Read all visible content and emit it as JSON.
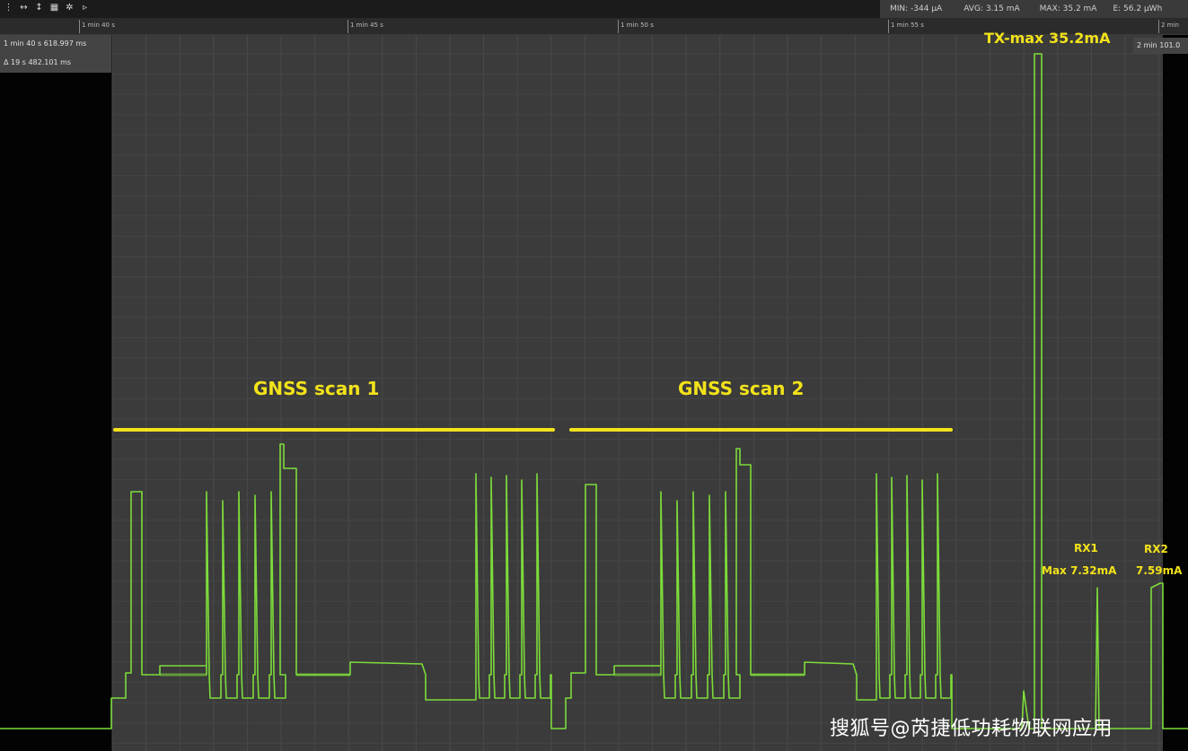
{
  "toolbar": {
    "icons": [
      "more-icon",
      "expand-horizontal-icon",
      "expand-vertical-icon",
      "grid-icon",
      "settings-icon",
      "play-icon"
    ]
  },
  "stats": {
    "min": "MIN: -344 µA",
    "avg": "AVG: 3.15 mA",
    "max": "MAX: 35.2 mA",
    "energy": "E: 56.2 µWh"
  },
  "timeline": {
    "ticks": [
      "1 min 40 s",
      "1 min 45 s",
      "1 min 50 s",
      "1 min 55 s",
      "2 min"
    ]
  },
  "cursor": {
    "start": "1 min 40 s 618.997 ms",
    "delta": "Δ 19 s 482.101 ms",
    "end": "2 min 101.0"
  },
  "annotations": {
    "scan1": "GNSS scan 1",
    "scan2": "GNSS scan 2",
    "tx": "TX-max 35.2mA",
    "rx1_title": "RX1",
    "rx1_value": "Max 7.32mA",
    "rx2_title": "RX2",
    "rx2_value": "7.59mA"
  },
  "watermark": "搜狐号@芮捷低功耗物联网应用",
  "colors": {
    "trace": "#7ddc3a",
    "annotation": "#f2e21a",
    "plot_bg": "#3b3b3b"
  }
}
